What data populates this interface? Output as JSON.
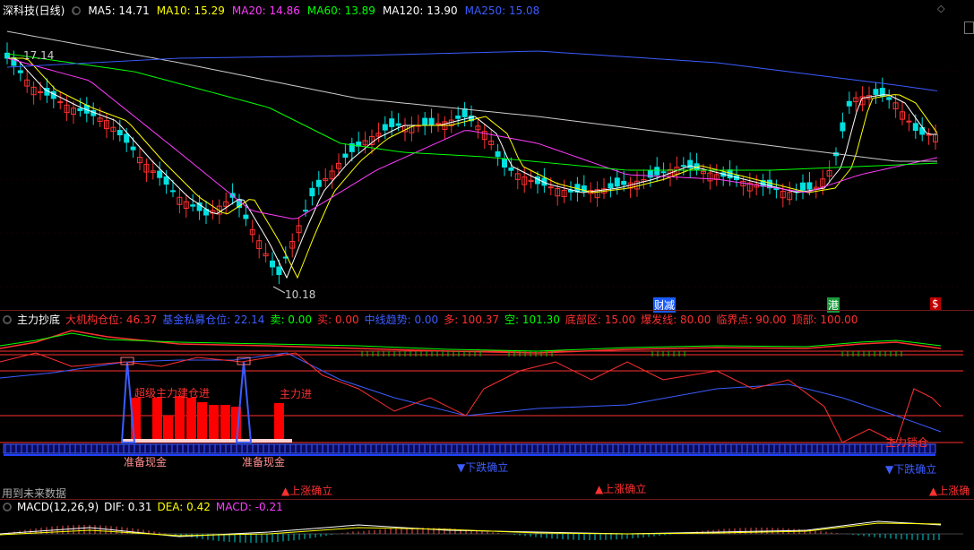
{
  "header": {
    "title": "深科技(日线)",
    "ma": [
      {
        "label": "MA5: 14.71",
        "color": "#ffffff"
      },
      {
        "label": "MA10: 15.29",
        "color": "#ffff00"
      },
      {
        "label": "MA20: 14.86",
        "color": "#ff3cff"
      },
      {
        "label": "MA60: 13.89",
        "color": "#00ff00"
      },
      {
        "label": "MA120: 13.90",
        "color": "#ffffff"
      },
      {
        "label": "MA250: 15.08",
        "color": "#3c5cff"
      }
    ]
  },
  "price_pane": {
    "high_label": "17.14",
    "low_label": "10.18",
    "markers": [
      {
        "text": "财",
        "bg": "#1a5cff"
      },
      {
        "text": "减",
        "bg": "#1a5cff"
      },
      {
        "text": "港",
        "bg": "#1a9a3a"
      },
      {
        "text": "$",
        "bg": "#c00000"
      }
    ]
  },
  "indicator1": {
    "name": "主力抄底",
    "values": [
      {
        "label": "大机构仓位: 46.37",
        "color": "#ff3030"
      },
      {
        "label": "基金私募仓位: 22.14",
        "color": "#3c5cff"
      },
      {
        "label": "卖: 0.00",
        "color": "#00ff00"
      },
      {
        "label": "买: 0.00",
        "color": "#ff3030"
      },
      {
        "label": "中线趋势: 0.00",
        "color": "#3c5cff"
      },
      {
        "label": "多: 100.37",
        "color": "#ffffff"
      },
      {
        "label": "空: 101.30",
        "color": "#00ff00"
      },
      {
        "label": "底部区: 15.00",
        "color": "#ff3030"
      },
      {
        "label": "爆发线: 80.00",
        "color": "#ff3030"
      },
      {
        "label": "临界点: 90.00",
        "color": "#ff3030"
      },
      {
        "label": "顶部: 100.00",
        "color": "#ff3030"
      }
    ],
    "annotations": {
      "super_main": "超级主力建仓进",
      "main_in": "主力进",
      "cash1": "准备现金",
      "cash2": "准备现金",
      "down1": "▼下跌确立",
      "down2": "▼下跌确立",
      "main_lock": "主力锁仓",
      "up1": "▲上涨确立",
      "up2": "▲上涨确立",
      "up3": "▲上涨确"
    },
    "future_data": "用到未来数据"
  },
  "macd": {
    "name": "MACD(12,26,9)",
    "values": [
      {
        "label": "DIF: 0.31",
        "color": "#ffffff"
      },
      {
        "label": "DEA: 0.42",
        "color": "#ffff00"
      },
      {
        "label": "MACD: -0.21",
        "color": "#ff3cff"
      }
    ]
  },
  "corner_icons": [
    "diamond-icon",
    "scroll-icon"
  ]
}
